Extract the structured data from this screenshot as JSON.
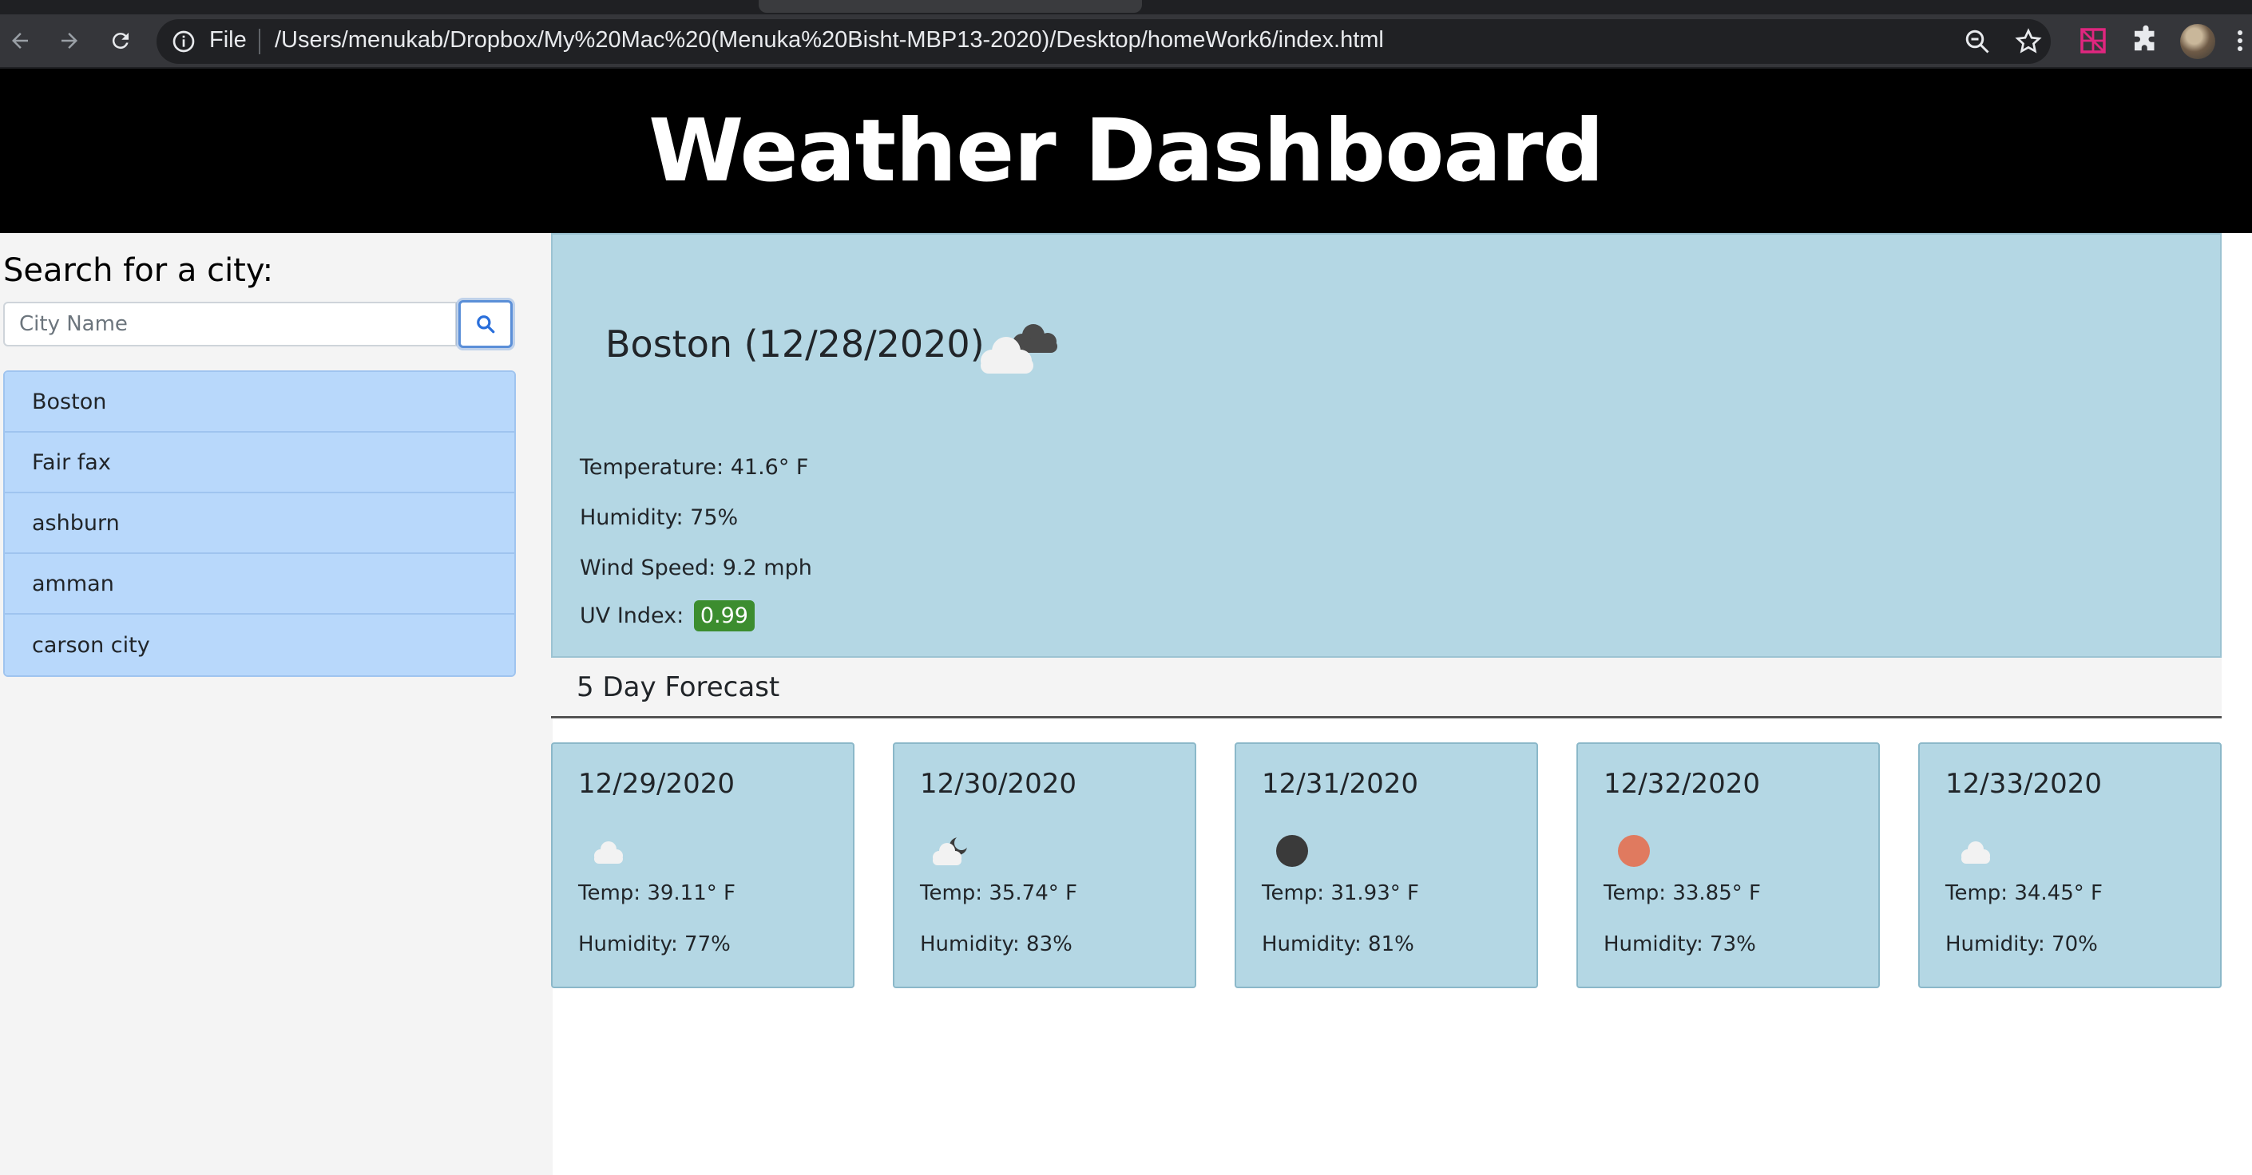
{
  "browser": {
    "omnibox_scheme": "File",
    "url": "/Users/menukab/Dropbox/My%20Mac%20(Menuka%20Bisht-MBP13-2020)/Desktop/homeWork6/index.html"
  },
  "header": {
    "title": "Weather Dashboard"
  },
  "search": {
    "label": "Search for a city:",
    "placeholder": "City Name",
    "value": "",
    "button_icon": "search-icon"
  },
  "history": [
    "Boston",
    "Fair fax",
    "ashburn",
    "amman",
    "carson city"
  ],
  "current": {
    "title": "Boston (12/28/2020)",
    "icon": "broken-clouds-icon",
    "temperature": "Temperature: 41.6° F",
    "humidity": "Humidity: 75%",
    "wind": "Wind Speed: 9.2 mph",
    "uv_label": "UV Index:",
    "uv_value": "0.99",
    "uv_color": "#3c8d2f"
  },
  "forecast": {
    "heading": "5 Day Forecast",
    "days": [
      {
        "date": "12/29/2020",
        "icon": "cloud-icon",
        "temp": "Temp: 39.11° F",
        "humidity": "Humidity: 77%"
      },
      {
        "date": "12/30/2020",
        "icon": "partly-cloudy-night-icon",
        "temp": "Temp: 35.74° F",
        "humidity": "Humidity: 83%"
      },
      {
        "date": "12/31/2020",
        "icon": "clear-night-icon",
        "temp": "Temp: 31.93° F",
        "humidity": "Humidity: 81%"
      },
      {
        "date": "12/32/2020",
        "icon": "sun-icon",
        "temp": "Temp: 33.85° F",
        "humidity": "Humidity: 73%"
      },
      {
        "date": "12/33/2020",
        "icon": "cloud-icon",
        "temp": "Temp: 34.45° F",
        "humidity": "Humidity: 70%"
      }
    ]
  },
  "colors": {
    "header_bg": "#000000",
    "card_bg": "#b4d7e4",
    "history_item_bg": "#b8d8fb",
    "sidebar_bg": "#f4f4f4"
  }
}
